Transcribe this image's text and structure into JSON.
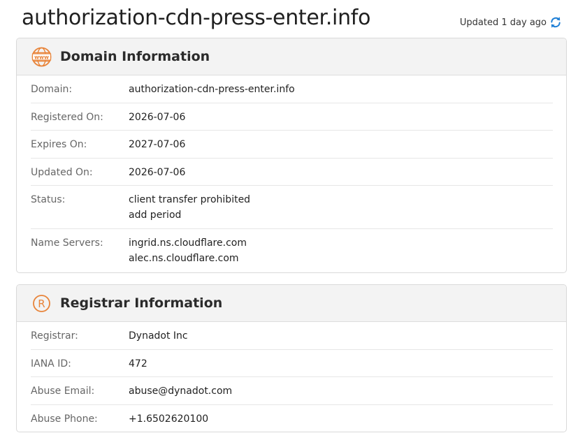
{
  "header": {
    "domain": "authorization-cdn-press-enter.info",
    "updated_text": "Updated 1 day ago"
  },
  "domain_info": {
    "title": "Domain Information",
    "icon": "www-globe-icon",
    "rows": [
      {
        "label": "Domain:",
        "values": [
          "authorization-cdn-press-enter.info"
        ]
      },
      {
        "label": "Registered On:",
        "values": [
          "2026-07-06"
        ]
      },
      {
        "label": "Expires On:",
        "values": [
          "2027-07-06"
        ]
      },
      {
        "label": "Updated On:",
        "values": [
          "2026-07-06"
        ]
      },
      {
        "label": "Status:",
        "values": [
          "client transfer prohibited",
          "add period"
        ]
      },
      {
        "label": "Name Servers:",
        "values": [
          "ingrid.ns.cloudflare.com",
          "alec.ns.cloudflare.com"
        ]
      }
    ]
  },
  "registrar_info": {
    "title": "Registrar Information",
    "icon": "registered-trademark-icon",
    "rows": [
      {
        "label": "Registrar:",
        "values": [
          "Dynadot Inc"
        ]
      },
      {
        "label": "IANA ID:",
        "values": [
          "472"
        ]
      },
      {
        "label": "Abuse Email:",
        "values": [
          "abuse@dynadot.com"
        ]
      },
      {
        "label": "Abuse Phone:",
        "values": [
          "+1.6502620100"
        ]
      }
    ]
  },
  "colors": {
    "accent_orange": "#e8843a",
    "refresh_blue": "#1e7fd6",
    "header_bg": "#f3f3f3",
    "border": "#d9d9d9"
  }
}
